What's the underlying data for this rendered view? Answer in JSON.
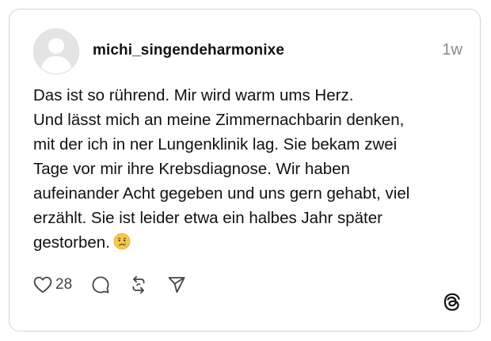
{
  "post": {
    "username": "michi_singendeharmonixe",
    "time": "1w",
    "text_lines": [
      "Das ist so rührend. Mir wird warm ums Herz.",
      "Und lässt mich an meine Zimmernachbarin denken,",
      "mit der ich in ner Lungenklinik lag. Sie bekam zwei",
      "Tage vor mir ihre Krebsdiagnose. Wir haben",
      "aufeinander Acht gegeben und uns gern gehabt, viel",
      "erzählt. Sie ist leider etwa ein halbes Jahr später",
      "gestorben."
    ],
    "emoji": "crying-face-emoji",
    "like_count": "28"
  },
  "icons": {
    "like": "heart-icon",
    "reply": "comment-icon",
    "repost": "repost-icon",
    "share": "send-icon",
    "brand": "threads-logo-icon"
  },
  "colors": {
    "border": "#d4d4d4",
    "text": "#111111",
    "muted": "#8a8a8a",
    "icon": "#444444"
  }
}
